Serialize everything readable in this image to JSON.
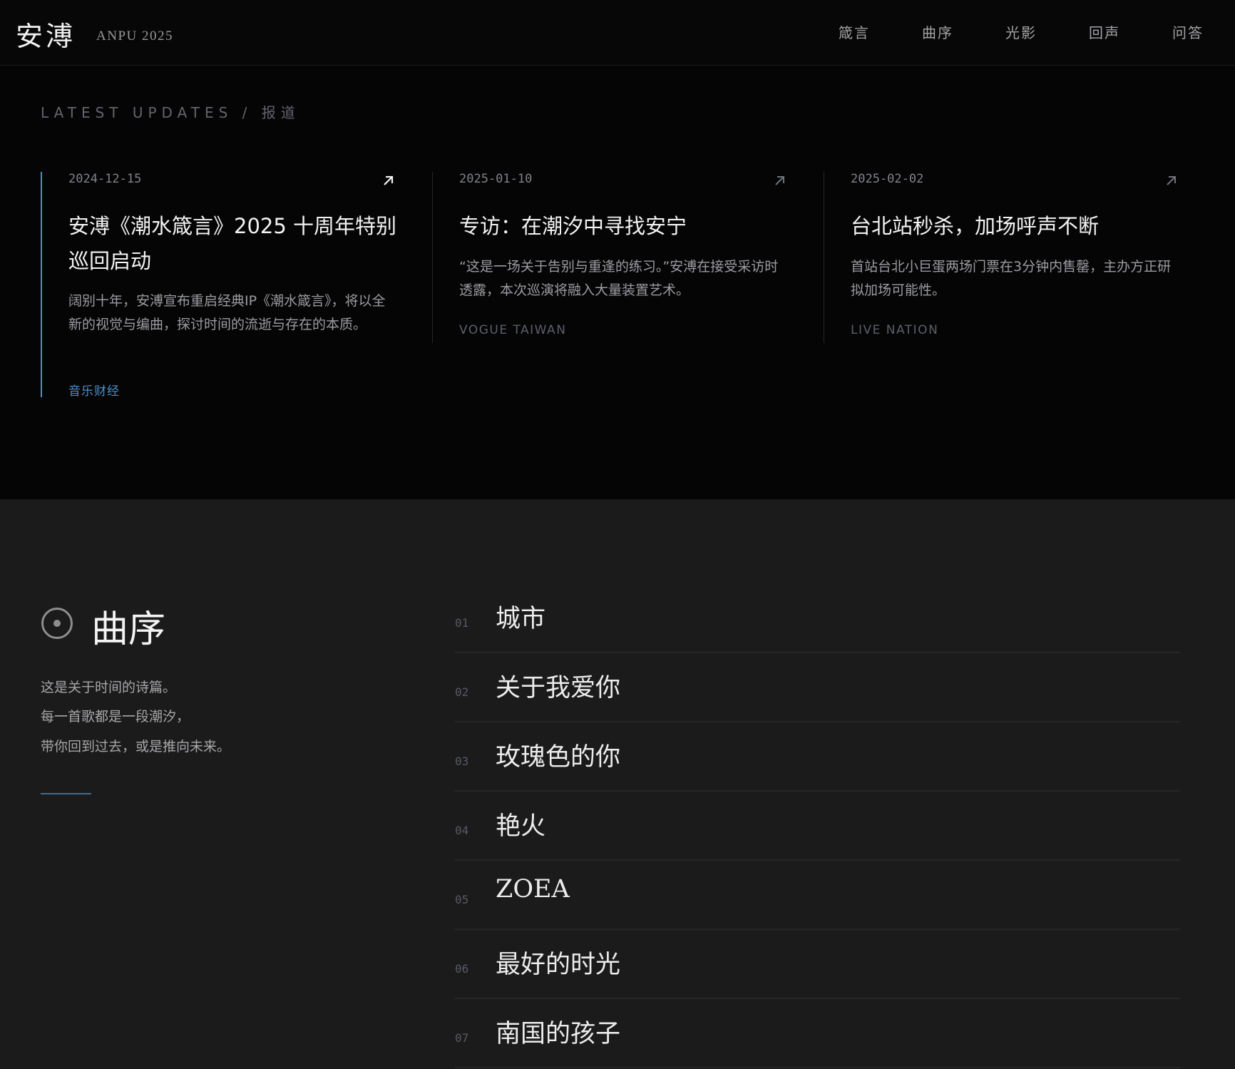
{
  "header": {
    "logo": "安溥",
    "subtitle": "ANPU 2025",
    "nav": [
      "箴言",
      "曲序",
      "光影",
      "回声",
      "问答"
    ]
  },
  "updates": {
    "kicker": "LATEST UPDATES / 报道",
    "cards": [
      {
        "date": "2024-12-15",
        "title": "安溥《潮水箴言》2025 十周年特别巡回启动",
        "desc": "阔别十年，安溥宣布重启经典IP《潮水箴言》，将以全新的视觉与编曲，探讨时间的流逝与存在的本质。",
        "source": "音乐财经"
      },
      {
        "date": "2025-01-10",
        "title": "专访：在潮汐中寻找安宁",
        "desc": "“这是一场关于告别与重逢的练习。”安溥在接受采访时透露，本次巡演将融入大量装置艺术。",
        "source": "VOGUE TAIWAN"
      },
      {
        "date": "2025-02-02",
        "title": "台北站秒杀，加场呼声不断",
        "desc": "首站台北小巨蛋两场门票在3分钟内售罄，主办方正研拟加场可能性。",
        "source": "LIVE NATION"
      }
    ]
  },
  "tracklist": {
    "heading": "曲序",
    "intro": [
      "这是关于时间的诗篇。",
      "每一首歌都是一段潮汐，",
      "带你回到过去，或是推向未来。"
    ],
    "tracks": [
      {
        "num": "01",
        "title": "城市"
      },
      {
        "num": "02",
        "title": "关于我爱你"
      },
      {
        "num": "03",
        "title": "玫瑰色的你"
      },
      {
        "num": "04",
        "title": "艳火"
      },
      {
        "num": "05",
        "title": "ZOEA"
      },
      {
        "num": "06",
        "title": "最好的时光"
      },
      {
        "num": "07",
        "title": "南国的孩子"
      }
    ]
  },
  "colors": {
    "accent": "#4a8fd0",
    "bg_dark": "#050505",
    "bg_section": "#1b1b1b"
  }
}
